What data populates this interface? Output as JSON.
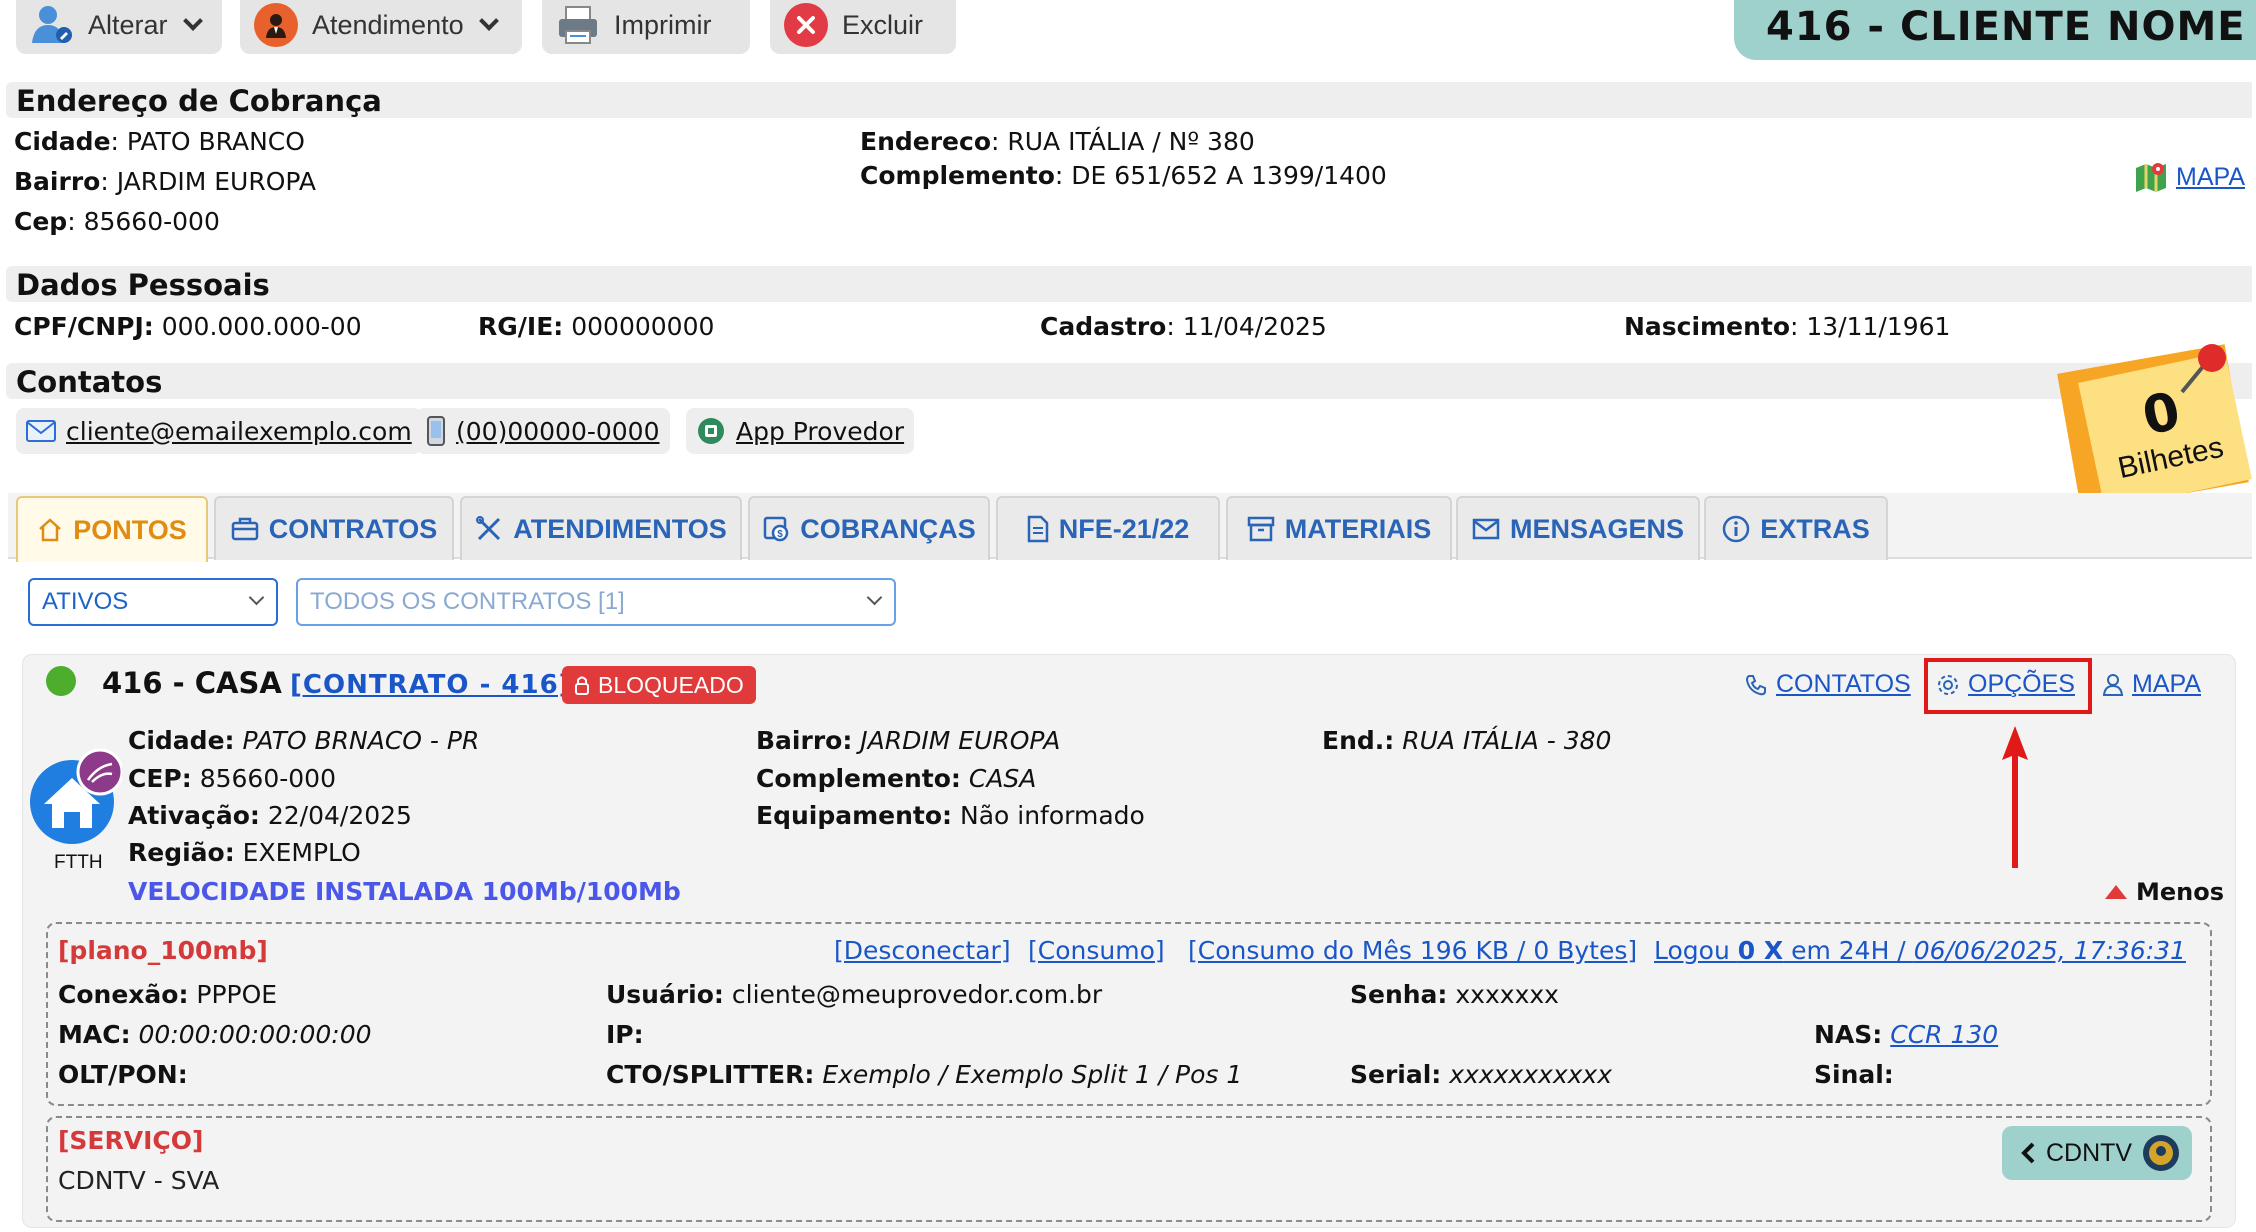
{
  "toolbar": {
    "alterar": "Alterar",
    "atendimento": "Atendimento",
    "imprimir": "Imprimir",
    "excluir": "Excluir"
  },
  "client_title": "416 - CLIENTE NOME",
  "billing": {
    "heading": "Endereço de Cobrança",
    "cidade_label": "Cidade",
    "cidade": "PATO BRANCO",
    "bairro_label": "Bairro",
    "bairro": "JARDIM EUROPA",
    "cep_label": "Cep",
    "cep": "85660-000",
    "endereco_label": "Endereco",
    "endereco": "RUA ITÁLIA / Nº 380",
    "complemento_label": "Complemento",
    "complemento": "DE 651/652 A 1399/1400",
    "mapa": "MAPA"
  },
  "personal": {
    "heading": "Dados Pessoais",
    "cpf_label": "CPF/CNPJ:",
    "cpf": "000.000.000-00",
    "rg_label": "RG/IE:",
    "rg": "000000000",
    "cadastro_label": "Cadastro",
    "cadastro": "11/04/2025",
    "nascimento_label": "Nascimento",
    "nascimento": "13/11/1961"
  },
  "contacts": {
    "heading": "Contatos",
    "email": "cliente@emailexemplo.com",
    "phone": "(00)00000-0000",
    "app": "App Provedor"
  },
  "tickets": {
    "count": "0",
    "label": "Bilhetes"
  },
  "tabs": [
    "PONTOS",
    "CONTRATOS",
    "ATENDIMENTOS",
    "COBRANÇAS",
    "NFE-21/22",
    "MATERIAIS",
    "MENSAGENS",
    "EXTRAS"
  ],
  "filters": {
    "status": "ATIVOS",
    "contracts": "TODOS OS CONTRATOS [1]"
  },
  "point": {
    "title": "416 - CASA",
    "contract_link": "[CONTRATO - 416]",
    "status_badge": "BLOQUEADO",
    "actions": {
      "contatos": "CONTATOS",
      "opcoes": "OPÇÕES",
      "mapa": "MAPA"
    },
    "tech": "FTTH",
    "cidade_label": "Cidade:",
    "cidade": "PATO BRNACO - PR",
    "cep_label": "CEP:",
    "cep": "85660-000",
    "ativacao_label": "Ativação:",
    "ativacao": "22/04/2025",
    "regiao_label": "Região:",
    "regiao": "EXEMPLO",
    "velocidade": "VELOCIDADE INSTALADA 100Mb/100Mb",
    "bairro_label": "Bairro:",
    "bairro": "JARDIM EUROPA",
    "complemento_label": "Complemento:",
    "complemento": "CASA",
    "equipamento_label": "Equipamento:",
    "equipamento": "Não informado",
    "end_label": "End.:",
    "end": "RUA ITÁLIA - 380",
    "menos": "Menos"
  },
  "plan": {
    "name": "[plano_100mb]",
    "desconectar": "[Desconectar]",
    "consumo": "[Consumo]",
    "consumo_mes": "[Consumo do Mês 196 KB / 0 Bytes]",
    "logou_prefix": "Logou ",
    "logou_count": "0 X",
    "logou_suffix": " em 24H / ",
    "logou_date": "06/06/2025, 17:36:31",
    "conexao_label": "Conexão:",
    "conexao": "PPPOE",
    "mac_label": "MAC:",
    "mac": "00:00:00:00:00:00",
    "olt_label": "OLT/PON:",
    "usuario_label": "Usuário:",
    "usuario": "cliente@meuprovedor.com.br",
    "ip_label": "IP:",
    "cto_label": "CTO/SPLITTER:",
    "cto": "Exemplo / Exemplo Split 1 / Pos 1",
    "senha_label": "Senha:",
    "senha": "xxxxxxx",
    "serial_label": "Serial:",
    "serial": "xxxxxxxxxxx",
    "nas_label": "NAS:",
    "nas": "CCR 130",
    "sinal_label": "Sinal:"
  },
  "service": {
    "heading": "[SERVIÇO]",
    "name": "CDNTV - SVA",
    "button": "CDNTV"
  }
}
